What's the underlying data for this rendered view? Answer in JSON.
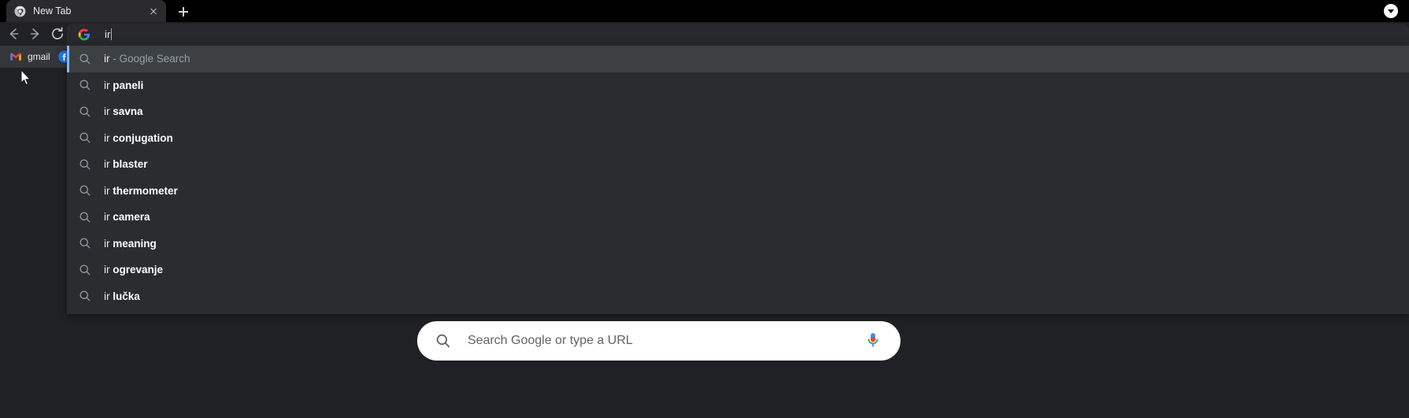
{
  "window": {
    "titlebar_chevron_icon": "chevron-down-icon"
  },
  "tabstrip": {
    "tabs": [
      {
        "title": "New Tab",
        "favicon": "chrome-favicon",
        "close_icon": "close-icon"
      }
    ],
    "new_tab_label": "+",
    "new_tab_icon": "plus-icon"
  },
  "toolbar": {
    "back_icon": "arrow-left-icon",
    "forward_icon": "arrow-right-icon",
    "reload_icon": "reload-icon"
  },
  "bookmarks": {
    "items": [
      {
        "label": "gmail",
        "icon": "gmail-icon"
      },
      {
        "label": "",
        "icon": "facebook-icon"
      }
    ],
    "overflow_label": "»",
    "overflow_icon": "chevron-double-right-icon"
  },
  "omnibox": {
    "search_engine_icon": "google-g-icon",
    "value": "ir",
    "placeholder": "Search Google or type a URL",
    "accent_color": "#8ab4f8"
  },
  "suggestions": {
    "selected_index": 0,
    "items": [
      {
        "icon": "search-icon",
        "typed": "ir",
        "rest": "",
        "desc": " - Google Search",
        "selected": true
      },
      {
        "icon": "search-icon",
        "typed": "ir",
        "rest": " paneli",
        "desc": "",
        "selected": false
      },
      {
        "icon": "search-icon",
        "typed": "ir",
        "rest": " savna",
        "desc": "",
        "selected": false
      },
      {
        "icon": "search-icon",
        "typed": "ir",
        "rest": " conjugation",
        "desc": "",
        "selected": false
      },
      {
        "icon": "search-icon",
        "typed": "ir",
        "rest": " blaster",
        "desc": "",
        "selected": false
      },
      {
        "icon": "search-icon",
        "typed": "ir",
        "rest": " thermometer",
        "desc": "",
        "selected": false
      },
      {
        "icon": "search-icon",
        "typed": "ir",
        "rest": " camera",
        "desc": "",
        "selected": false
      },
      {
        "icon": "search-icon",
        "typed": "ir",
        "rest": " meaning",
        "desc": "",
        "selected": false
      },
      {
        "icon": "search-icon",
        "typed": "ir",
        "rest": " ogrevanje",
        "desc": "",
        "selected": false
      },
      {
        "icon": "search-icon",
        "typed": "ir",
        "rest": " lučka",
        "desc": "",
        "selected": false
      }
    ]
  },
  "new_tab_page": {
    "search_placeholder": "Search Google or type a URL",
    "search_icon": "search-icon",
    "mic_icon": "microphone-icon"
  },
  "cursor": {
    "icon": "mouse-pointer-icon"
  }
}
